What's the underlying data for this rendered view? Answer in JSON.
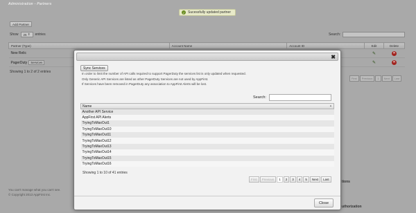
{
  "background": {
    "page_title": "Administration - Partners",
    "flash_message": "Sucessfully updated partner",
    "add_partner_label": "Add Partner",
    "show_label": "Show",
    "show_value": "25",
    "entries_label": "entries",
    "search_label": "Search:",
    "columns": [
      "Partner (Type)",
      "Account Name",
      "Account ID",
      "Edit",
      "Delete"
    ],
    "rows": [
      {
        "partner": "New Relic",
        "tag": ""
      },
      {
        "partner": "PagerDuty",
        "tag": "Services"
      }
    ],
    "info": "Showing 1 to 2 of 2 entries",
    "pager": [
      "First",
      "Previous",
      "1",
      "Next",
      "Last"
    ],
    "footer_line1": "You can't manage what you can't see.",
    "footer_line2": "© Copyright 2013 AppFirst Inc.",
    "footer_right1": "tions",
    "footer_right2": "uthorization"
  },
  "modal": {
    "sync_button": "Sync Services",
    "description": [
      "In order to limit the number of API calls required to support PagerDuty the services list is only updated when requested.",
      "Only Generic API Services are listed as other PagerDuty Services are not used by AppFirst.",
      "If Services have been removed in PagerDuty any association to AppFirst Alerts will be lost."
    ],
    "search_label": "Search:",
    "search_value": "",
    "column_header": "Name",
    "rows": [
      "Another API Service",
      "AppFirst API Alerts",
      "TryingToMaxOut1",
      "TryingToMaxOut10",
      "TryingToMaxOut11",
      "TryingToMaxOut12",
      "TryingToMaxOut13",
      "TryingToMaxOut14",
      "TryingToMaxOut15",
      "TryingToMaxOut16"
    ],
    "info": "Showing 1 to 10 of 41 entries",
    "pager": {
      "first": "First",
      "previous": "Previous",
      "pages": [
        "1",
        "2",
        "3",
        "4",
        "5"
      ],
      "next": "Next",
      "last": "Last"
    },
    "close_button": "Close"
  }
}
